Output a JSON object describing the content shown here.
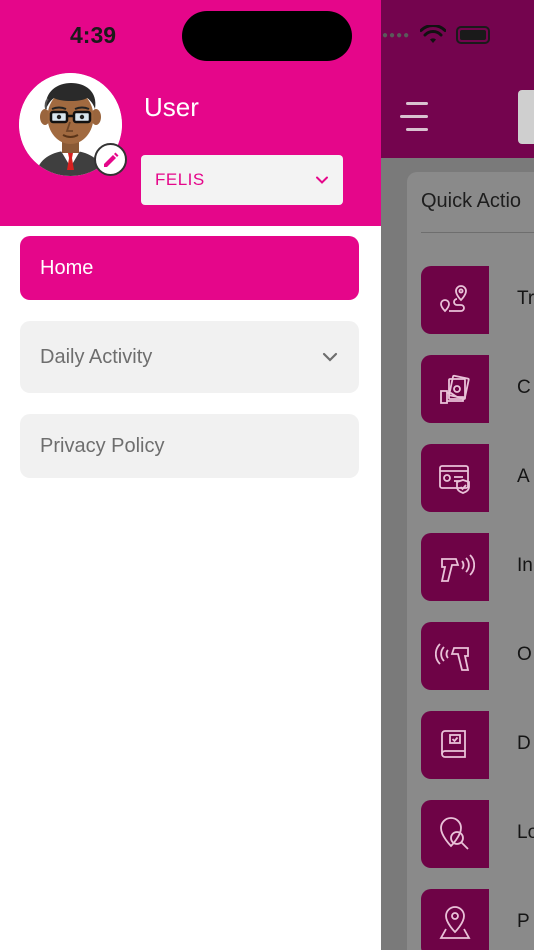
{
  "status_bar": {
    "time": "4:39"
  },
  "profile": {
    "name": "User",
    "organization": "FELIS"
  },
  "menu": {
    "items": [
      {
        "label": "Home",
        "active": true
      },
      {
        "label": "Daily Activity",
        "expandable": true
      },
      {
        "label": "Privacy Policy"
      }
    ]
  },
  "background": {
    "section_title": "Quick Actio",
    "quick_actions": [
      {
        "label": "Tr",
        "icon": "route-icon"
      },
      {
        "label": "C",
        "icon": "cash-icon"
      },
      {
        "label": "A",
        "icon": "id-card-check-icon"
      },
      {
        "label": "In",
        "icon": "scanner-in-icon"
      },
      {
        "label": "O",
        "icon": "scanner-out-icon"
      },
      {
        "label": "D",
        "icon": "document-icon"
      },
      {
        "label": "Lo",
        "icon": "location-search-icon"
      },
      {
        "label": "P",
        "icon": "map-pin-icon"
      }
    ]
  },
  "colors": {
    "primary": "#e5068a",
    "primary_dark": "#6e0346",
    "menu_bg": "#f1f1f1",
    "menu_text": "#6e6e6e"
  }
}
